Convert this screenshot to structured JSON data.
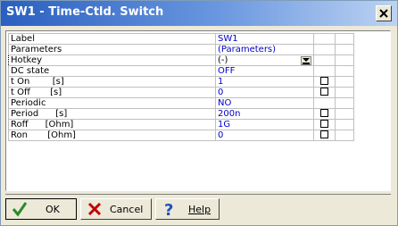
{
  "window": {
    "title": "SW1 - Time-Ctld. Switch"
  },
  "grid": {
    "rows": [
      {
        "label": "Label",
        "value": "SW1",
        "checkbox": false
      },
      {
        "label": "Parameters",
        "value": "(Parameters)",
        "checkbox": false
      },
      {
        "label": "Hotkey",
        "value": "(-)",
        "checkbox": false,
        "dropdown": true
      },
      {
        "label": "DC state",
        "value": "OFF",
        "checkbox": false
      },
      {
        "label": "t On        [s]",
        "value": "1",
        "checkbox": true
      },
      {
        "label": "t Off       [s]",
        "value": "0",
        "checkbox": true
      },
      {
        "label": "Periodic",
        "value": "NO",
        "checkbox": false
      },
      {
        "label": "Period      [s]",
        "value": "200n",
        "checkbox": true
      },
      {
        "label": "Roff      [Ohm]",
        "value": "1G",
        "checkbox": true
      },
      {
        "label": "Ron       [Ohm]",
        "value": "0",
        "checkbox": true
      }
    ]
  },
  "buttons": {
    "ok": "OK",
    "cancel": "Cancel",
    "help": "Help"
  },
  "icons": {
    "close": "close-icon",
    "ok": "checkmark-icon",
    "cancel": "x-icon",
    "help": "question-icon",
    "dropdown": "dropdown-arrow-icon"
  },
  "colors": {
    "title_bg": "#2a5fc0",
    "value_text": "#0000cc",
    "ok_check": "#2a8a2a",
    "cancel_x": "#c00000",
    "help_q": "#2050c0"
  }
}
